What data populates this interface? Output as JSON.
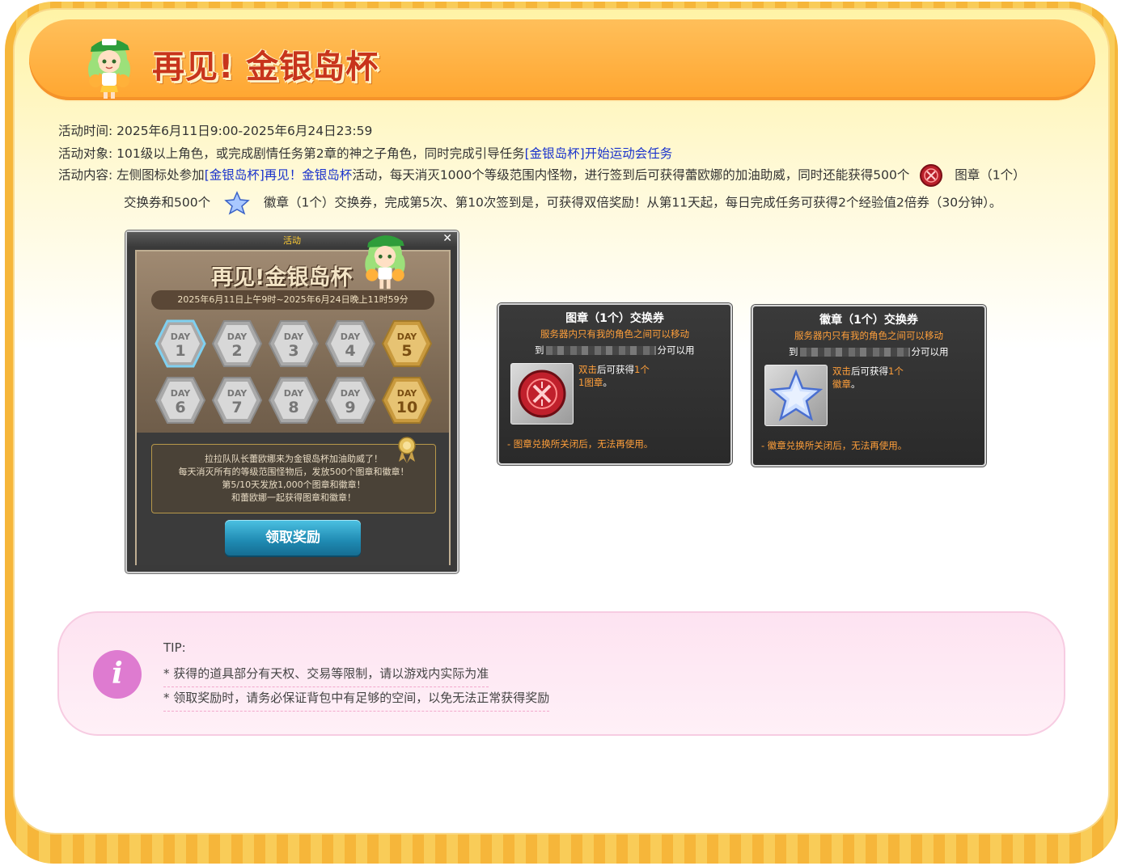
{
  "header": {
    "title": "再见! 金银岛杯"
  },
  "info": {
    "time_label": "活动时间:",
    "time_value": "2025年6月11日9:00-2025年6月24日23:59",
    "target_label": "活动对象:",
    "target_text": "101级以上角色，或完成剧情任务第2章的神之子角色，同时完成引导任务",
    "target_link": "[金银岛杯]开始运动会任务",
    "content_label": "活动内容:",
    "content_pre": "左侧图标处参加",
    "content_link1": "[金银岛杯]再见！",
    "content_link2": "金银岛杯",
    "content_mid": "活动，每天消灭1000个等级范围内怪物，进行签到后可获得蕾欧娜的加油助威，同时还能获得500个",
    "content_seal": "图章（1个）",
    "content_line2_pre": "交换券和500个",
    "content_line2_post": "徽章（1个）交换券，完成第5次、第10次签到是，可获得双倍奖励！从第11天起，每日完成任务可获得2个经验值2倍券（30分钟）。"
  },
  "game_window": {
    "titlebar": "活动",
    "close": "✕",
    "title": "再见!金银岛杯",
    "date": "2025年6月11日上午9时~2025年6月24日晚上11时59分",
    "days": [
      {
        "label": "DAY",
        "num": "1"
      },
      {
        "label": "DAY",
        "num": "2"
      },
      {
        "label": "DAY",
        "num": "3"
      },
      {
        "label": "DAY",
        "num": "4"
      },
      {
        "label": "DAY",
        "num": "5"
      },
      {
        "label": "DAY",
        "num": "6"
      },
      {
        "label": "DAY",
        "num": "7"
      },
      {
        "label": "DAY",
        "num": "8"
      },
      {
        "label": "DAY",
        "num": "9"
      },
      {
        "label": "DAY",
        "num": "10"
      }
    ],
    "msg_line1": "拉拉队队长蕾欧娜来为金银岛杯加油助威了！",
    "msg_line2": "每天消灭所有的等级范围怪物后，发放500个图章和徽章！",
    "msg_line3": "第5/10天发放1,000个图章和徽章！",
    "msg_line4": "和蕾欧娜一起获得图章和徽章！",
    "button": "领取奖励"
  },
  "card_seal": {
    "title": "图章（1个）交换券",
    "sub": "服务器内只有我的角色之间可以移动",
    "until_pre": "到",
    "until_post": "分可以用",
    "desc_a": "双击",
    "desc_b": "后可获得",
    "desc_c": "1个",
    "desc_d": "1图章",
    "desc_e": "。",
    "foot": "- 图章兑换所关闭后，无法再使用。"
  },
  "card_badge": {
    "title": "徽章（1个）交换券",
    "sub": "服务器内只有我的角色之间可以移动",
    "until_pre": "到",
    "until_post": "分可以用",
    "desc_a": "双击",
    "desc_b": "后可获得",
    "desc_c": "1个",
    "desc_d": "徽章",
    "desc_e": "。",
    "foot": "- 徽章兑换所关闭后，无法再使用。"
  },
  "tip": {
    "label": "TIP:",
    "line1": "* 获得的道具部分有天权、交易等限制，请以游戏内实际为准",
    "line2": "* 领取奖励时，请务必保证背包中有足够的空间，以免无法正常获得奖励"
  },
  "colors": {
    "accent": "#ffa630",
    "title": "#c8341c",
    "link": "#1a33cc",
    "tip_bg": "#fde3f1",
    "tip_icon": "#de7bd0"
  }
}
